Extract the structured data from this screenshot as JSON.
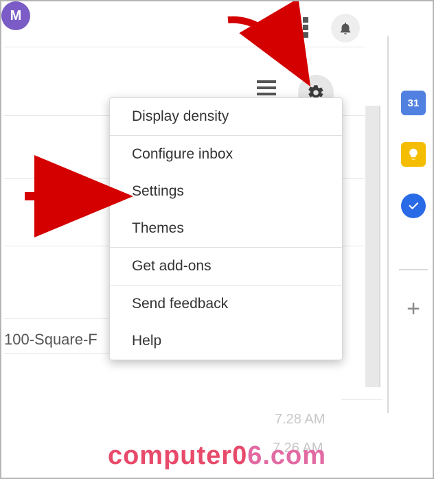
{
  "header": {
    "avatar_letter": "M",
    "calendar_day": "31"
  },
  "menu": {
    "items": [
      "Display density",
      "Configure inbox",
      "Settings",
      "Themes",
      "Get add-ons",
      "Send feedback",
      "Help"
    ]
  },
  "rows": {
    "row1": "100-Square-F"
  },
  "times": {
    "t1": "7.28 AM",
    "t2": "7.26 AM"
  },
  "watermark": {
    "prefix": "computer0",
    "suffix": "6.com"
  }
}
